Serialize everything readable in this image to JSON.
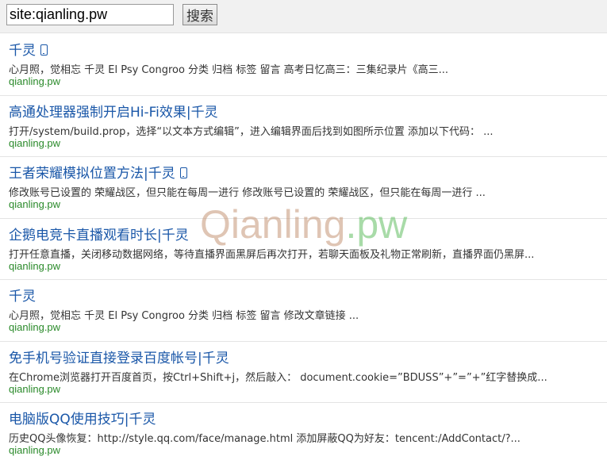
{
  "search": {
    "query": "site:qianling.pw",
    "button_label": "搜索"
  },
  "results": [
    {
      "title": "千灵",
      "mobile_icon": true,
      "snippet": "心月照，觉相忘 千灵 El    Psy    Congroo 分类 归档 标签 留言 高考日忆高三：三集纪录片《高三...",
      "url": "qianling.pw"
    },
    {
      "title": "高通处理器强制开启Hi-Fi效果|千灵",
      "mobile_icon": false,
      "snippet": "打开/system/build.prop，选择“以文本方式编辑”，进入编辑界面后找到如图所示位置 添加以下代码： ...",
      "url": "qianling.pw"
    },
    {
      "title": "王者荣耀模拟位置方法|千灵",
      "mobile_icon": true,
      "snippet": "修改账号已设置的 荣耀战区，但只能在每周一进行 修改账号已设置的 荣耀战区，但只能在每周一进行 ...",
      "url": "qianling.pw"
    },
    {
      "title": "企鹅电竞卡直播观看时长|千灵",
      "mobile_icon": false,
      "snippet": "打开任意直播，关闭移动数据网络，等待直播界面黑屏后再次打开，若聊天面板及礼物正常刷新，直播界面仍黑屏...",
      "url": "qianling.pw"
    },
    {
      "title": "千灵",
      "mobile_icon": false,
      "snippet": "心月照，觉相忘 千灵 El    Psy    Congroo 分类 归档 标签 留言 修改文章链接 ...",
      "url": "qianling.pw"
    },
    {
      "title": "免手机号验证直接登录百度帐号|千灵",
      "mobile_icon": false,
      "snippet": "在Chrome浏览器打开百度首页，按Ctrl+Shift+j，然后敲入： document.cookie=”BDUSS”+”=”+”红字替换成...",
      "url": "qianling.pw"
    },
    {
      "title": "电脑版QQ使用技巧|千灵",
      "mobile_icon": false,
      "snippet": "历史QQ头像恢复：http://style.qq.com/face/manage.html 添加屏蔽QQ为好友：tencent:/AddContact/?...",
      "url": "qianling.pw"
    }
  ],
  "watermark": {
    "part1": "Qianling",
    "part2": ".pw"
  },
  "colors": {
    "title": "#1a57a8",
    "url": "#2a8a2a",
    "snippet": "#333333"
  }
}
